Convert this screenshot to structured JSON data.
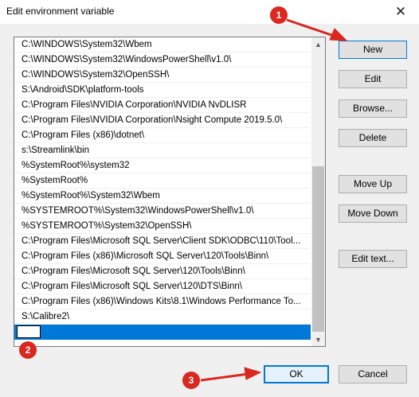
{
  "window": {
    "title": "Edit environment variable",
    "close_glyph": "✕"
  },
  "list": {
    "items": [
      "C:\\WINDOWS\\System32\\Wbem",
      "C:\\WINDOWS\\System32\\WindowsPowerShell\\v1.0\\",
      "C:\\WINDOWS\\System32\\OpenSSH\\",
      "S:\\Android\\SDK\\platform-tools",
      "C:\\Program Files\\NVIDIA Corporation\\NVIDIA NvDLISR",
      "C:\\Program Files\\NVIDIA Corporation\\Nsight Compute 2019.5.0\\",
      "C:\\Program Files (x86)\\dotnet\\",
      "s:\\Streamlink\\bin",
      "%SystemRoot%\\system32",
      "%SystemRoot%",
      "%SystemRoot%\\System32\\Wbem",
      "%SYSTEMROOT%\\System32\\WindowsPowerShell\\v1.0\\",
      "%SYSTEMROOT%\\System32\\OpenSSH\\",
      "C:\\Program Files\\Microsoft SQL Server\\Client SDK\\ODBC\\110\\Tool...",
      "C:\\Program Files (x86)\\Microsoft SQL Server\\120\\Tools\\Binn\\",
      "C:\\Program Files\\Microsoft SQL Server\\120\\Tools\\Binn\\",
      "C:\\Program Files\\Microsoft SQL Server\\120\\DTS\\Binn\\",
      "C:\\Program Files (x86)\\Windows Kits\\8.1\\Windows Performance To...",
      "S:\\Calibre2\\"
    ],
    "new_entry_value": ""
  },
  "scrollbar": {
    "up_glyph": "▲",
    "down_glyph": "▼"
  },
  "buttons": {
    "new": "New",
    "edit": "Edit",
    "browse": "Browse...",
    "delete": "Delete",
    "move_up": "Move Up",
    "move_down": "Move Down",
    "edit_text": "Edit text...",
    "ok": "OK",
    "cancel": "Cancel"
  },
  "markers": {
    "step1": "1",
    "step2": "2",
    "step3": "3",
    "color": "#d9281f"
  },
  "colors": {
    "selection": "#0078d7",
    "dialog_bg": "#f0f0f0"
  }
}
